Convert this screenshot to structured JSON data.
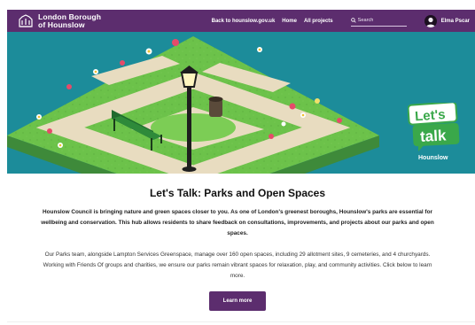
{
  "header": {
    "council_name": "London Borough of Hounslow",
    "council_name_line1": "London Borough",
    "council_name_line2": "of Hounslow",
    "nav": [
      {
        "label": "Back to hounslow.gov.uk"
      },
      {
        "label": "Home"
      },
      {
        "label": "All projects"
      }
    ],
    "search_placeholder": "Search",
    "user_name": "Elma Pscar"
  },
  "hero": {
    "badge_line1": "Let's",
    "badge_line2": "talk",
    "badge_line3": "Hounslow"
  },
  "main": {
    "title": "Let's Talk: Parks and Open Spaces",
    "intro": "Hounslow Council is bringing nature and green spaces closer to you. As one of London's greenest boroughs, Hounslow's parks are essential for wellbeing and conservation.  This hub allows residents to share feedback on consultations, improvements, and projects about our parks and open spaces.",
    "body": "Our Parks team, alongside Lampton Services Greenspace, manage over 160 open spaces, including 29 allotment sites, 9 cemeteries, and 4 churchyards. Working with Friends Of groups and charities, we ensure our parks remain vibrant spaces for relaxation, play, and community activities. Click below to learn more.",
    "button_label": "Learn more"
  },
  "colors": {
    "brand_purple": "#5c2d6e",
    "hero_teal": "#1c8c9a",
    "grass_green": "#6cc24a",
    "path_beige": "#e8dcc0",
    "badge_green": "#3aa84a"
  },
  "icons": {
    "logo": "council-crest-icon",
    "search": "search-icon",
    "avatar": "user-avatar-icon"
  }
}
